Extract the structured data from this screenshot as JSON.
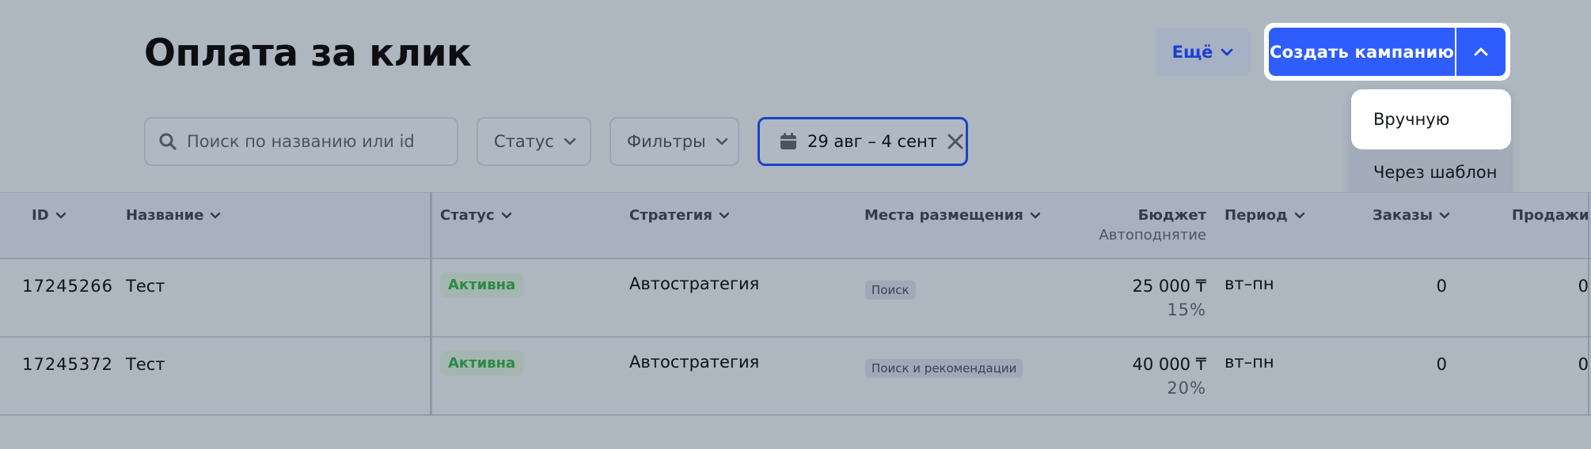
{
  "page": {
    "title": "Оплата за клик"
  },
  "header": {
    "more_label": "Ещё",
    "create_label": "Создать кампанию",
    "dropdown_items": [
      "Вручную",
      "Через шаблон"
    ]
  },
  "filters": {
    "search_placeholder": "Поиск по названию или id",
    "status_label": "Статус",
    "filters_label": "Фильтры",
    "date_range": "29 авг – 4 сент"
  },
  "table": {
    "columns": {
      "id": "ID",
      "name": "Название",
      "status": "Статус",
      "strategy": "Стратегия",
      "placements": "Места размещения",
      "budget": "Бюджет",
      "budget_sub": "Автоподнятие",
      "period": "Период",
      "orders": "Заказы",
      "sales": "Продажи"
    },
    "rows": [
      {
        "id": "17245266",
        "name": "Тест",
        "status": "Активна",
        "strategy": "Автостратегия",
        "placement": "Поиск",
        "budget": "25 000 ₸",
        "autoraise": "15%",
        "period": "вт–пн",
        "orders": "0",
        "sales": "0"
      },
      {
        "id": "17245372",
        "name": "Тест",
        "status": "Активна",
        "strategy": "Автостратегия",
        "placement": "Поиск и рекомендации",
        "budget": "40 000 ₸",
        "autoraise": "20%",
        "period": "вт–пн",
        "orders": "0",
        "sales": "0"
      }
    ]
  },
  "colors": {
    "accent": "#2e5dfb",
    "status_active": "#2a8a45",
    "date_border": "#1f43c6"
  }
}
